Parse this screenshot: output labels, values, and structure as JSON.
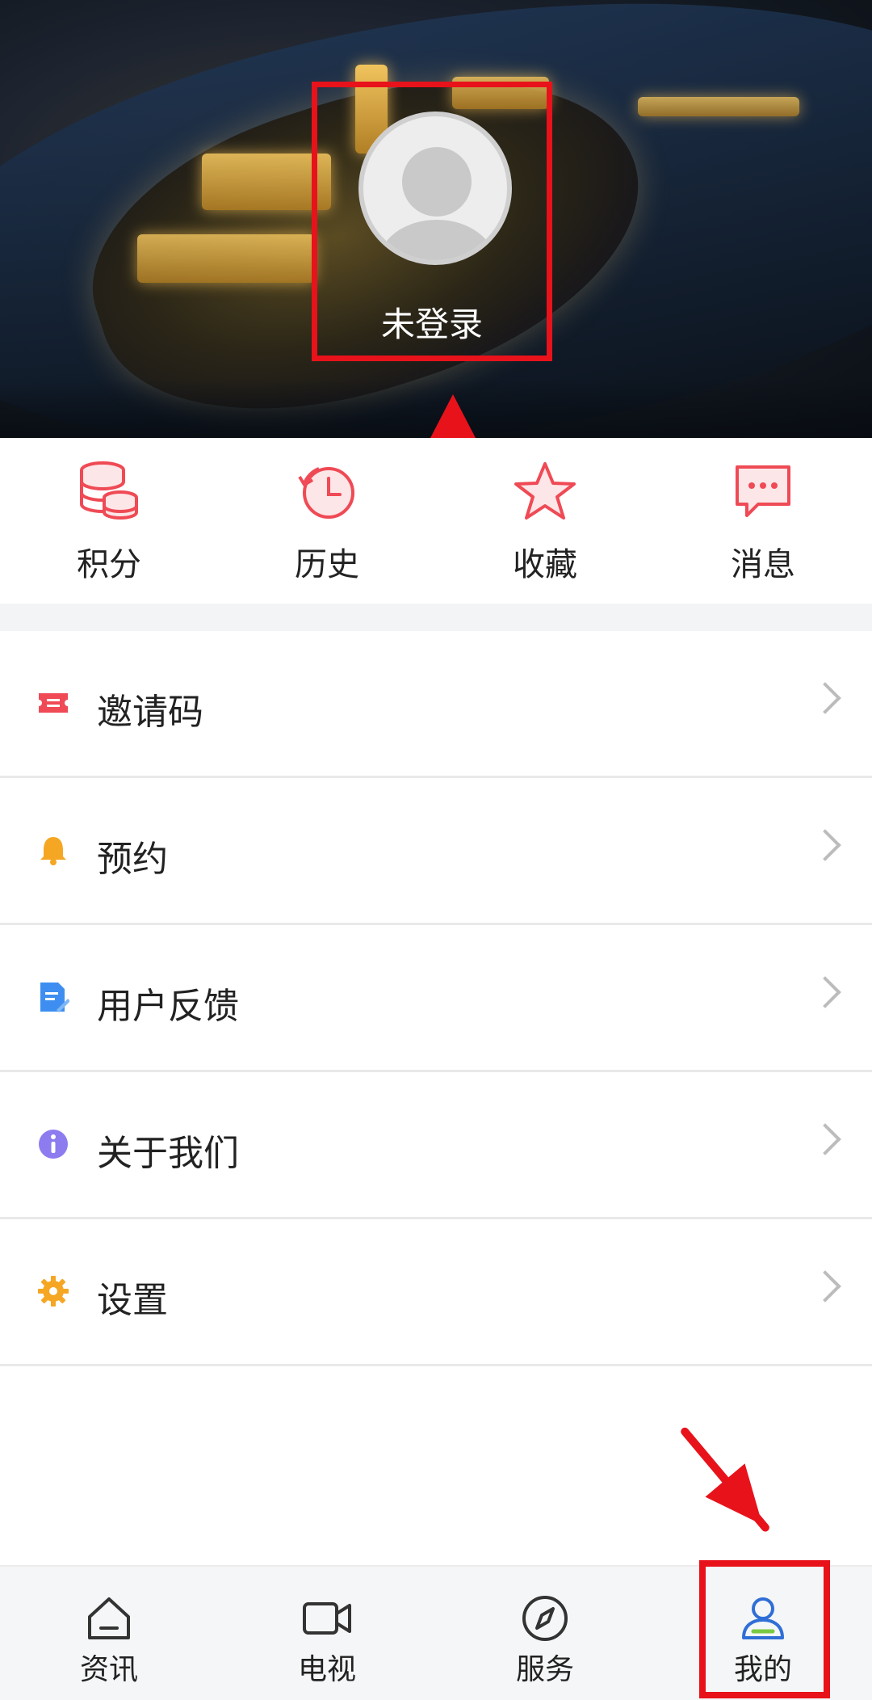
{
  "header": {
    "login_status": "未登录",
    "avatar_icon": "default-avatar-icon"
  },
  "quick_actions": [
    {
      "label": "积分",
      "icon": "coins-stack-icon"
    },
    {
      "label": "历史",
      "icon": "history-clock-icon"
    },
    {
      "label": "收藏",
      "icon": "star-icon"
    },
    {
      "label": "消息",
      "icon": "message-bubble-icon"
    }
  ],
  "menu": [
    {
      "label": "邀请码",
      "icon": "ticket-icon",
      "color": "#ef4a55"
    },
    {
      "label": "预约",
      "icon": "bell-icon",
      "color": "#f5a623"
    },
    {
      "label": "用户反馈",
      "icon": "feedback-doc-icon",
      "color": "#3d8ef0"
    },
    {
      "label": "关于我们",
      "icon": "info-icon",
      "color": "#8c7cf0"
    },
    {
      "label": "设置",
      "icon": "gear-icon",
      "color": "#f5a623"
    }
  ],
  "tabs": [
    {
      "label": "资讯",
      "icon": "home-icon"
    },
    {
      "label": "电视",
      "icon": "video-camera-icon"
    },
    {
      "label": "服务",
      "icon": "compass-icon"
    },
    {
      "label": "我的",
      "icon": "user-icon",
      "active": true
    }
  ],
  "colors": {
    "accent": "#e8121b",
    "icon_red": "#ef4a55",
    "active_tab": "#2f6fd6"
  }
}
